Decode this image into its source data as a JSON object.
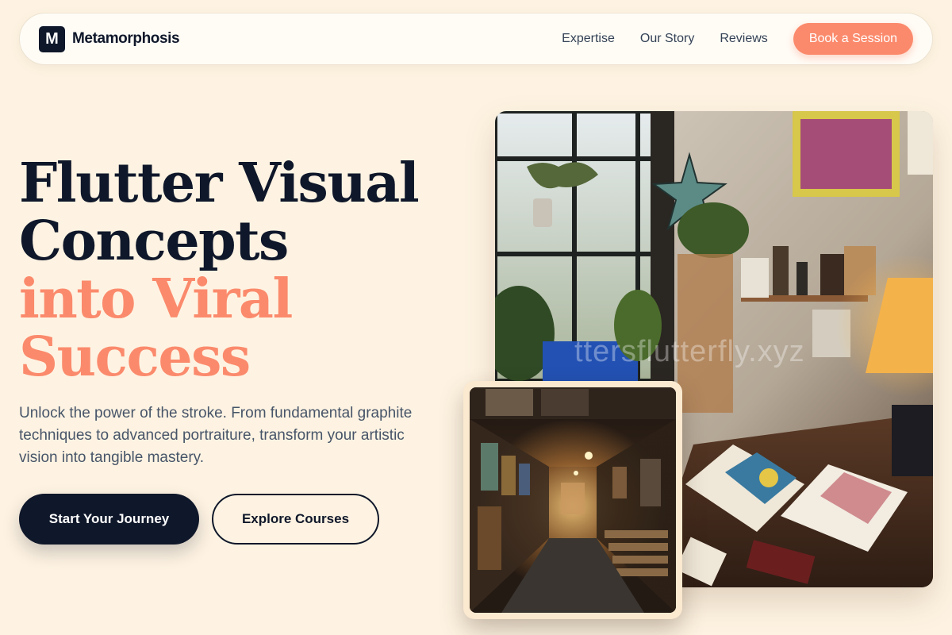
{
  "brand": {
    "mark": "M",
    "name": "Metamorphosis"
  },
  "nav": {
    "links": [
      "Expertise",
      "Our Story",
      "Reviews"
    ],
    "cta": "Book a Session"
  },
  "hero": {
    "title_lines": [
      "Flutter Visual",
      "Concepts"
    ],
    "title_accent_lines": [
      "into Viral",
      "Success"
    ],
    "subtitle": "Unlock the power of the stroke. From fundamental graphite techniques to advanced portraiture, transform your artistic vision into tangible mastery.",
    "primary_button": "Start Your Journey",
    "secondary_button": "Explore Courses"
  },
  "images": {
    "main_watermark": "ttersflutterfly.xyz",
    "main_subject": "art-studio-photo",
    "inset_subject": "gallery-corridor-photo"
  },
  "colors": {
    "background": "#fef3e2",
    "primary_dark": "#0f172a",
    "accent": "#fb8a6c",
    "body_text": "#475569"
  }
}
